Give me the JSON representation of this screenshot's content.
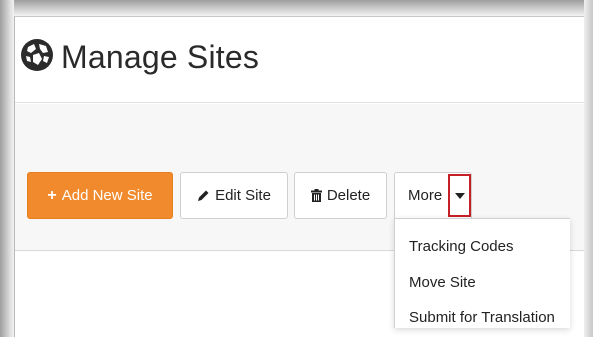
{
  "header": {
    "title": "Manage Sites",
    "icon": "globe-icon"
  },
  "toolbar": {
    "add_label": "Add New Site",
    "add_icon": "plus-icon",
    "edit_label": "Edit Site",
    "edit_icon": "pencil-icon",
    "delete_label": "Delete",
    "delete_icon": "trash-icon",
    "more_label": "More",
    "more_icon": "caret-down-icon"
  },
  "menu": {
    "items": [
      {
        "label": "Tracking Codes"
      },
      {
        "label": "Move Site"
      },
      {
        "label": "Submit for Translation"
      }
    ]
  },
  "colors": {
    "accent": "#f08a2c",
    "highlight": "#c62026",
    "text": "#222222"
  }
}
